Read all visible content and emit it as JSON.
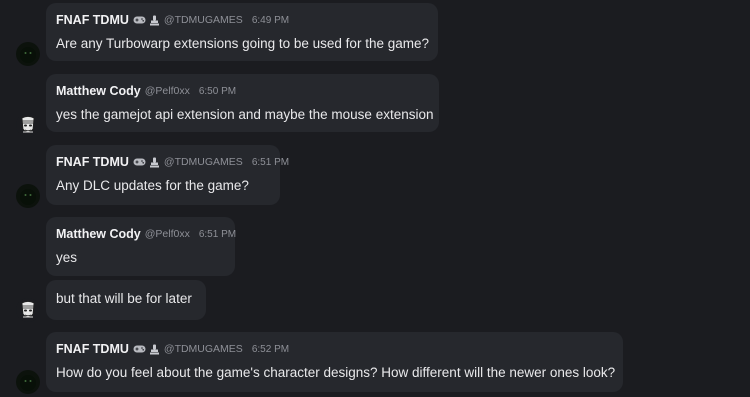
{
  "messages": [
    {
      "name": "FNAF TDMU",
      "handle": "@TDMUGAMES",
      "time": "6:49 PM",
      "text": "Are any Turbowarp extensions going to be used for the game?"
    },
    {
      "name": "Matthew Cody",
      "handle": "@Pelf0xx",
      "time": "6:50 PM",
      "text": "yes the gamejot api extension and maybe the mouse extension"
    },
    {
      "name": "FNAF TDMU",
      "handle": "@TDMUGAMES",
      "time": "6:51 PM",
      "text": "Any DLC updates for the game?"
    },
    {
      "name": "Matthew Cody",
      "handle": "@Pelf0xx",
      "time": "6:51 PM",
      "text": "yes"
    },
    {
      "text": "but that will be for later"
    },
    {
      "name": "FNAF TDMU",
      "handle": "@TDMUGAMES",
      "time": "6:52 PM",
      "text": "How do you feel about the game's character designs? How different will the newer ones look?"
    }
  ],
  "colors": {
    "background": "#1b1c20",
    "bubble": "#26282d",
    "muted": "#8e9097"
  }
}
